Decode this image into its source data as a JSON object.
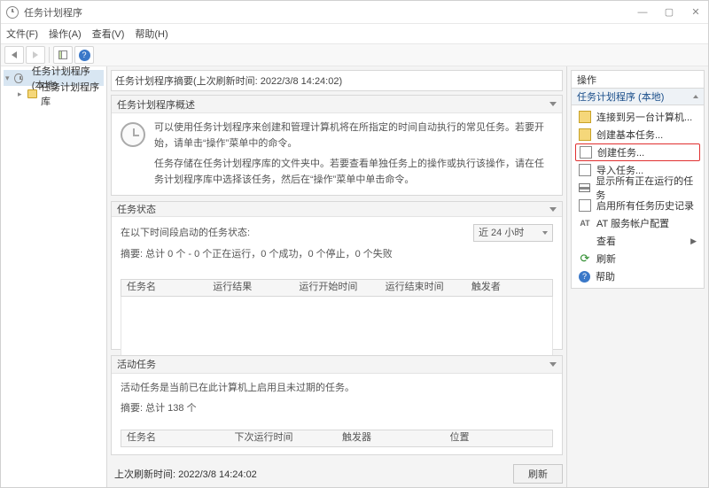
{
  "window": {
    "title": "任务计划程序"
  },
  "menu": {
    "file": "文件(F)",
    "action": "操作(A)",
    "view": "查看(V)",
    "help": "帮助(H)"
  },
  "tree": {
    "root": "任务计划程序 (本地)",
    "library": "任务计划程序库"
  },
  "main": {
    "summary_title": "任务计划程序摘要(上次刷新时间: 2022/3/8 14:24:02)",
    "overview": {
      "title": "任务计划程序概述",
      "p1": "可以使用任务计划程序来创建和管理计算机将在所指定的时间自动执行的常见任务。若要开始，请单击“操作”菜单中的命令。",
      "p2": "任务存储在任务计划程序库的文件夹中。若要查看单独任务上的操作或执行该操作，请在任务计划程序库中选择该任务，然后在“操作”菜单中单击命令。"
    },
    "status": {
      "title": "任务状态",
      "period_label": "在以下时间段启动的任务状态:",
      "period_value": "近 24 小时",
      "summary": "摘要: 总计 0 个 - 0 个正在运行，0 个成功，0 个停止，0 个失败",
      "columns": [
        "任务名",
        "运行结果",
        "运行开始时间",
        "运行结束时间",
        "触发者"
      ]
    },
    "active": {
      "title": "活动任务",
      "desc": "活动任务是当前已在此计算机上启用且未过期的任务。",
      "summary": "摘要: 总计 138 个",
      "columns": [
        "任务名",
        "下次运行时间",
        "触发器",
        "位置"
      ]
    },
    "last_refresh": "上次刷新时间: 2022/3/8 14:24:02",
    "refresh_btn": "刷新"
  },
  "actions": {
    "title": "操作",
    "context": "任务计划程序 (本地)",
    "items": [
      "连接到另一台计算机...",
      "创建基本任务...",
      "创建任务...",
      "导入任务...",
      "显示所有正在运行的任务",
      "启用所有任务历史记录",
      "AT 服务帐户配置",
      "查看",
      "刷新",
      "帮助"
    ]
  }
}
